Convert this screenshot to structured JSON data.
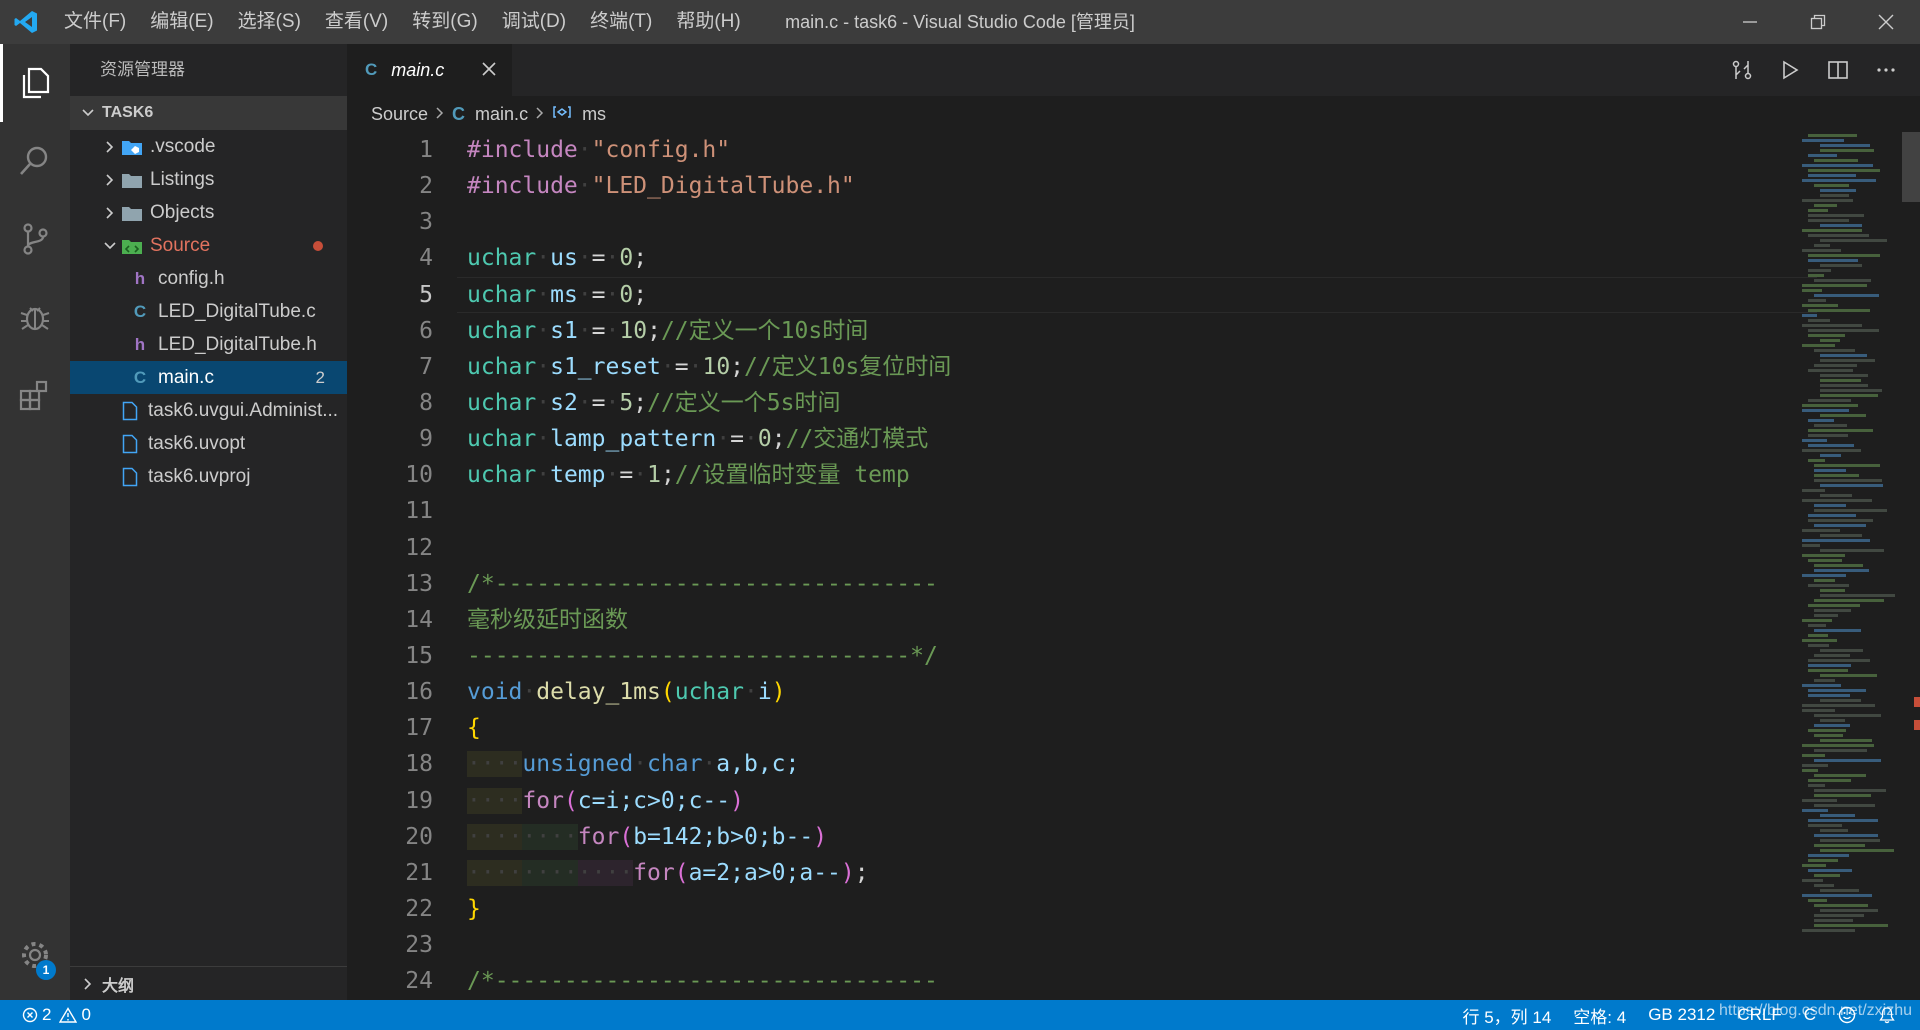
{
  "window": {
    "title": "main.c - task6 - Visual Studio Code [管理员]"
  },
  "menu": [
    "文件(F)",
    "编辑(E)",
    "选择(S)",
    "查看(V)",
    "转到(G)",
    "调试(D)",
    "终端(T)",
    "帮助(H)"
  ],
  "sidebar": {
    "title": "资源管理器",
    "project": "TASK6",
    "items": [
      {
        "label": ".vscode",
        "type": "folder"
      },
      {
        "label": "Listings",
        "type": "folder"
      },
      {
        "label": "Objects",
        "type": "folder"
      },
      {
        "label": "Source",
        "type": "folder-open"
      },
      {
        "label": "config.h",
        "type": "h"
      },
      {
        "label": "LED_DigitalTube.c",
        "type": "c"
      },
      {
        "label": "LED_DigitalTube.h",
        "type": "h"
      },
      {
        "label": "main.c",
        "type": "c",
        "badge": "2"
      },
      {
        "label": "task6.uvgui.Administ...",
        "type": "file"
      },
      {
        "label": "task6.uvopt",
        "type": "file"
      },
      {
        "label": "task6.uvproj",
        "type": "file"
      }
    ],
    "outline": "大纲"
  },
  "activity": {
    "settings_badge": "1"
  },
  "tab": {
    "icon": "C",
    "label": "main.c"
  },
  "breadcrumb": {
    "folder": "Source",
    "file_icon": "C",
    "file": "main.c",
    "symbol": "ms"
  },
  "editor": {
    "line_numbers": [
      "1",
      "2",
      "3",
      "4",
      "5",
      "6",
      "7",
      "8",
      "9",
      "10",
      "11",
      "12",
      "13",
      "14",
      "15",
      "16",
      "17",
      "18",
      "19",
      "20",
      "21",
      "22",
      "23",
      "24"
    ],
    "current_line": 5
  },
  "code": {
    "l1_a": "#include",
    "l1_b": "\"config.h\"",
    "l2_a": "#include",
    "l2_b": "\"LED_DigitalTube.h\"",
    "uchar": "uchar",
    "l4_v": "us",
    "l4_n": "0",
    "l5_v": "ms",
    "l5_n": "0",
    "l6_v": "s1",
    "l6_n": "10",
    "l6_c": "//定义一个10s时间",
    "l7_v": "s1_reset",
    "l7_n": "10",
    "l7_c": "//定义10s复位时间",
    "l8_v": "s2",
    "l8_n": "5",
    "l8_c": "//定义一个5s时间",
    "l9_v": "lamp_pattern",
    "l9_n": "0",
    "l9_c": "//交通灯模式",
    "l10_v": "temp",
    "l10_n": "1",
    "l10_c": "//设置临时变量 temp",
    "l13": "/*--------------------------------",
    "l14": "毫秒级延时函数",
    "l15": "--------------------------------*/",
    "l16_kw": "void",
    "l16_fn": "delay_1ms",
    "l16_p": "i",
    "l18_a": "unsigned",
    "l18_b": "char",
    "l18_c": "a,b,c;",
    "for": "for",
    "l19": "c=i;c>0;c--",
    "l20": "b=142;b>0;b--",
    "l21": "a=2;a>0;a--",
    "l24": "/*--------------------------------"
  },
  "statusbar": {
    "errors": "2",
    "warnings": "0",
    "position": "行 5，列 14",
    "spaces": "空格: 4",
    "encoding": "GB 2312",
    "eol": "CRLF",
    "language": "C",
    "watermark": "https://blog.csdn.net/zxizhu"
  }
}
